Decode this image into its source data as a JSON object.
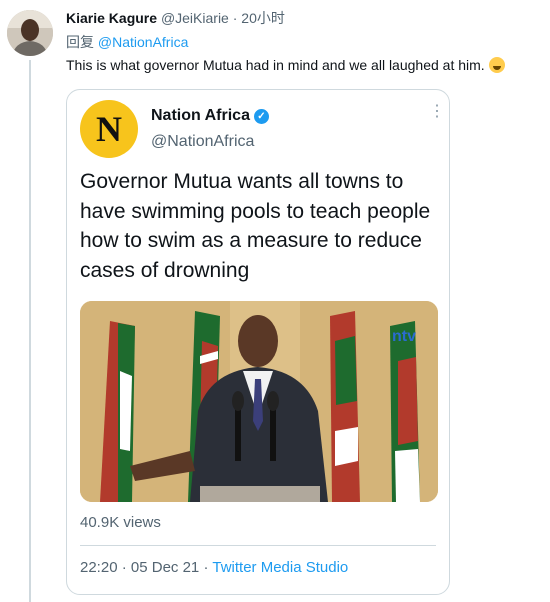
{
  "tweet": {
    "author_name": "Kiarie Kagure",
    "author_handle": "@JeiKiarie",
    "separator": "·",
    "time": "20小时",
    "reply_label": "回复",
    "reply_mention": "@NationAfrica",
    "text": "This is what governor Mutua had in mind and we all laughed at him.",
    "emoji_icon": "laughing-crying-emoji"
  },
  "quoted": {
    "avatar_letter": "N",
    "name": "Nation Africa",
    "verified_icon": "✓",
    "handle": "@NationAfrica",
    "more_icon": "⋮",
    "text": "Governor Mutua wants all towns to have swimming pools to teach people how to swim as a measure to reduce cases of drowning",
    "media_logo": "ntv",
    "views": "40.9K views",
    "time": "22:20",
    "separator": "·",
    "date": "05 Dec 21",
    "source": "Twitter Media Studio"
  },
  "colors": {
    "link": "#1d9bf0",
    "secondary_text": "#536471",
    "avatar_bg": "#f7c41c"
  }
}
